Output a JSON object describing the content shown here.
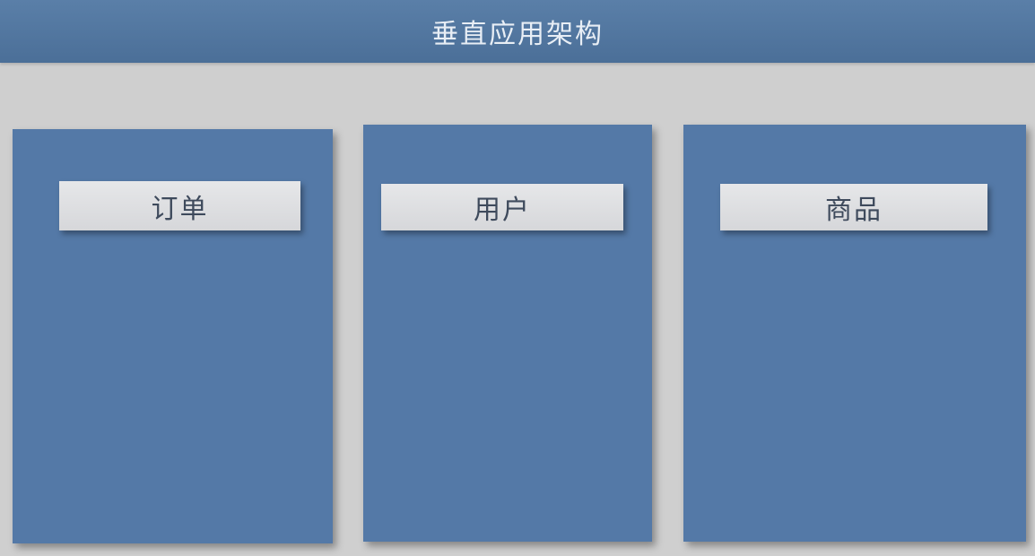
{
  "header": {
    "title": "垂直应用架构"
  },
  "columns": [
    {
      "module": "订单"
    },
    {
      "module": "用户"
    },
    {
      "module": "商品"
    }
  ],
  "colors": {
    "header": "#4b6f98",
    "column": "#5479a7",
    "module": "#dcdde0",
    "background": "#cfcfcf"
  }
}
